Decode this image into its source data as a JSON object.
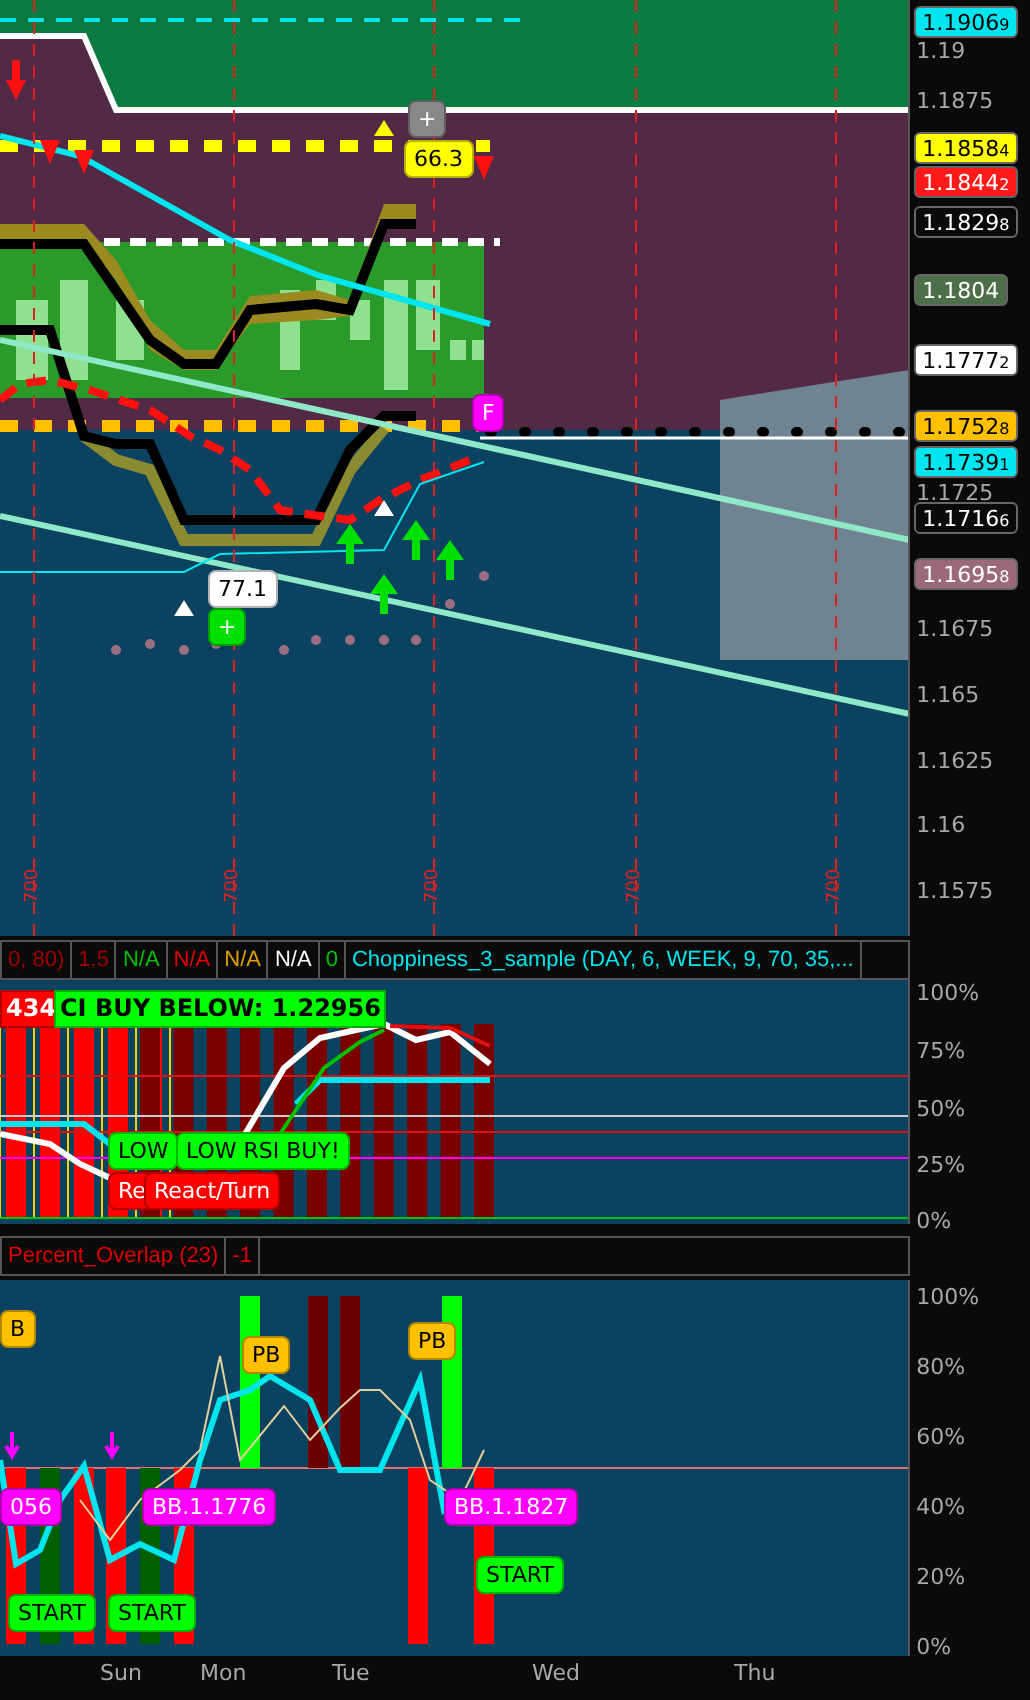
{
  "price_chart": {
    "price_labels": [
      {
        "price": "1.1906",
        "digit": "9",
        "color": "#00e5ee"
      },
      {
        "price": "1.1858",
        "digit": "4",
        "color": "#ffff00"
      },
      {
        "price": "1.1844",
        "digit": "2",
        "color": "#ff1a1a"
      },
      {
        "price": "1.1829",
        "digit": "8",
        "color": "#0a0a0a"
      },
      {
        "price": "1.1804",
        "color": "#4c6e48"
      },
      {
        "price": "1.1777",
        "digit": "2",
        "color": "#ffffff"
      },
      {
        "price": "1.1752",
        "digit": "8",
        "color": "#ffc000"
      },
      {
        "price": "1.1739",
        "digit": "1",
        "color": "#00e5ee"
      },
      {
        "price": "1.1716",
        "digit": "6",
        "color": "#0a0a0a"
      },
      {
        "price": "1.1695",
        "digit": "8",
        "color": "#9a6a7a"
      }
    ],
    "axis_ticks": [
      "1.19",
      "1.1875",
      "1.1725",
      "1.1675",
      "1.165",
      "1.1625",
      "1.16",
      "1.1575"
    ],
    "time_marks": [
      "700",
      "700",
      "700",
      "700",
      "700"
    ],
    "bubbles": [
      {
        "text": "+",
        "color": "#888888"
      },
      {
        "text": "66.3",
        "color": "#ffff00"
      },
      {
        "text": "F",
        "color": "#ff00ff"
      },
      {
        "text": "77.1",
        "color": "#ffffff"
      },
      {
        "text": "+",
        "color": "#00e000"
      }
    ]
  },
  "study_header": {
    "cells": [
      {
        "text": "0, 80)",
        "kind": "muted"
      },
      {
        "text": "1.5",
        "kind": "muted"
      },
      {
        "text": "N/A",
        "kind": "up"
      },
      {
        "text": "N/A",
        "kind": "down"
      },
      {
        "text": "N/A",
        "kind": "warn"
      },
      {
        "text": "N/A",
        "kind": "plain"
      },
      {
        "text": "0",
        "kind": "up"
      },
      {
        "text": "Choppiness_3_sample (DAY, 6, WEEK, 9, 70, 35,...",
        "kind": "study"
      }
    ]
  },
  "choppiness_panel": {
    "bubbles": [
      {
        "text": "434",
        "color": "#ff0000"
      },
      {
        "text": "CI BUY BELOW: 1.22956",
        "color": "#00ff00"
      },
      {
        "text": "LOW",
        "color": "#00ff00"
      },
      {
        "text": "LOW RSI BUY!",
        "color": "#00ff00"
      },
      {
        "text": "Re",
        "color": "#ff0000"
      },
      {
        "text": "React/Turn",
        "color": "#ff0000"
      }
    ],
    "axis_ticks": [
      "100%",
      "75%",
      "50%",
      "25%",
      "0%"
    ]
  },
  "overlap_header": {
    "cells": [
      {
        "text": "Percent_Overlap (23)",
        "kind": "down"
      },
      {
        "text": "-1",
        "kind": "down"
      }
    ]
  },
  "overlap_panel": {
    "bubbles": [
      {
        "text": "B",
        "color": "#ffc000"
      },
      {
        "text": "PB",
        "color": "#ffc000"
      },
      {
        "text": "PB",
        "color": "#ffc000"
      },
      {
        "text": "056",
        "color": "#ff00ff"
      },
      {
        "text": "BB.1.1776",
        "color": "#ff00ff"
      },
      {
        "text": "BB.1.1827",
        "color": "#ff00ff"
      },
      {
        "text": "START",
        "color": "#00ff00"
      },
      {
        "text": "START",
        "color": "#00ff00"
      },
      {
        "text": "START",
        "color": "#00ff00"
      }
    ],
    "axis_ticks": [
      "100%",
      "80%",
      "60%",
      "40%",
      "20%",
      "0%"
    ]
  },
  "day_labels": [
    "Sun",
    "Mon",
    "Tue",
    "Wed",
    "Thu"
  ]
}
